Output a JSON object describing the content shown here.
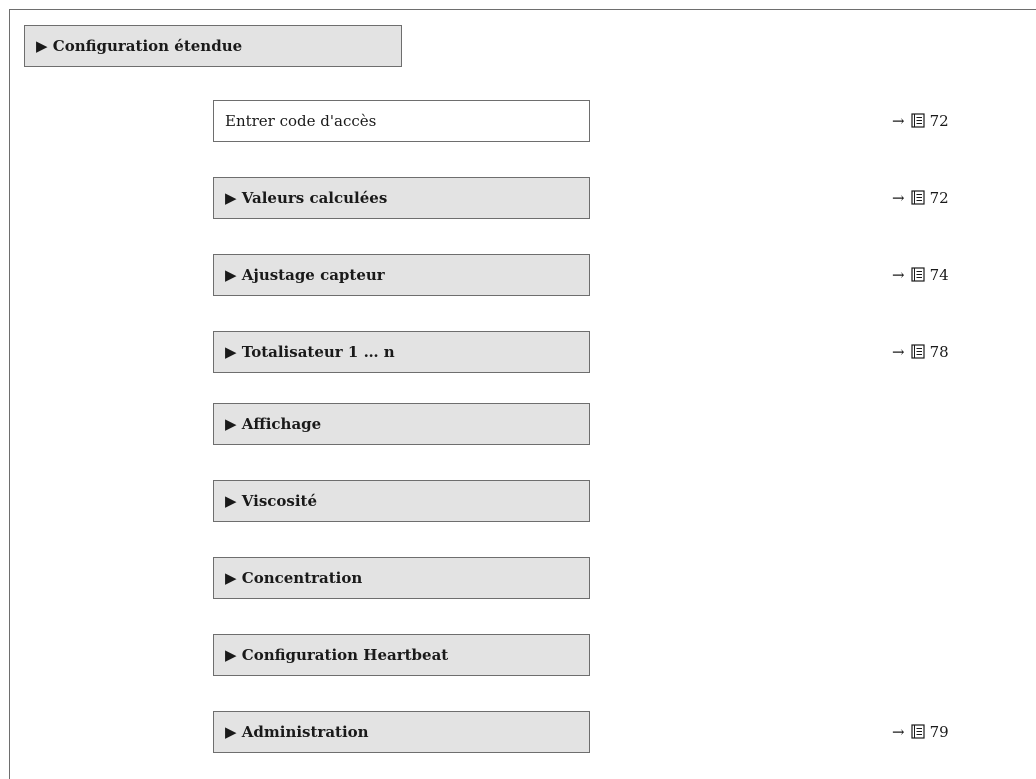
{
  "header": {
    "label": "▶ Configuration étendue"
  },
  "rows": [
    {
      "label": "Entrer code d'accès",
      "kind": "param",
      "arrow": "→",
      "page": "72",
      "icon": "book-icon"
    },
    {
      "label": "▶ Valeurs calculées",
      "kind": "sub",
      "arrow": "→",
      "page": "72",
      "icon": "book-icon"
    },
    {
      "label": "▶ Ajustage capteur",
      "kind": "sub",
      "arrow": "→",
      "page": "74",
      "icon": "book-icon"
    },
    {
      "label": "▶ Totalisateur 1 … n",
      "kind": "sub",
      "arrow": "→",
      "page": "78",
      "icon": "book-icon"
    },
    {
      "label": "▶ Affichage",
      "kind": "sub"
    },
    {
      "label": "▶ Viscosité",
      "kind": "sub"
    },
    {
      "label": "▶ Concentration",
      "kind": "sub"
    },
    {
      "label": "▶ Configuration Heartbeat",
      "kind": "sub"
    },
    {
      "label": "▶ Administration",
      "kind": "sub",
      "arrow": "→",
      "page": "79",
      "icon": "book-icon"
    }
  ],
  "colors": {
    "submenu_bg": "#e3e3e3",
    "border": "#6e6e6e",
    "text": "#1a1a1a"
  }
}
